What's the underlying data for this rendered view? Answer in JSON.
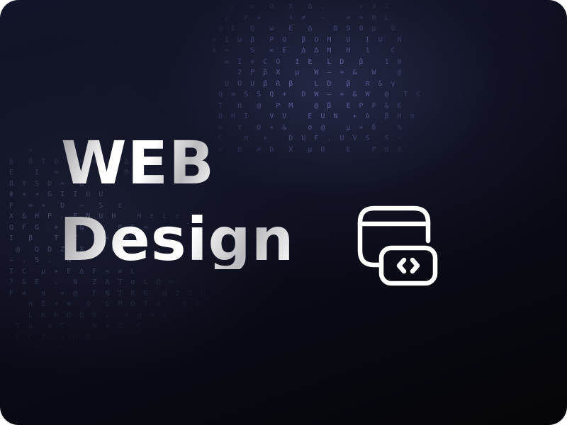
{
  "card": {
    "title_line1": "WEB",
    "title_line2": "Design",
    "icon": "browser-code-icon",
    "background_color": "#0b0c1a",
    "accent_color": "#8c96e6"
  },
  "matrix": {
    "top": "    α  ≠  Ο  X  Δ .     + X Z\n   μ  Ρ +    ÷ ≠  -   = ≈ H L\n  @ E  Q  ω  E  ∆   B 9 0 μ  6\n ≠ Ι ω β  Ρ Ο  β Ο Μ  U  I U  N\n Α +   S  ∞ E  ∆ ∆ M  H  1   C\n   ∞ Ι + C O  Ι E  L D  β   1 0\n     2 Ρ β X  μ  W – + &  W   @\n   U O U β R β   L D  β  R & γ\n  Q ∞ S S Q ∗  D W – + & W  @  T C\n  T  π  @  P M   @ β  E P F & E\n  B H I   V V   E U N  + A  β H π\n  ∞  Y  O ∗ &   σ @   μ + δ   %\n  C   π  +   D U F . U V S  S ·\n  ≠  B  ≠ D  X  μ O   E   P 8 X",
    "left": "    ≈     ∞  ≠    Ο\n β  δ Τ Ο ε ∞ ≠ Ο  ∆ .\n Ε   Ι  ∞    Ρ  Ω  Μ\n 8 Y S D ≈  ∆   H\n Φ + ∗ G I I U U\n F  ∞ ∗  D  –  S  ε\n X & H P . E N U H   H ε L ε\n Q F G  + & & ∞   B E ∞\n I  β   T  Z  ≈ ≈  ≈\n  @  Q D Z  X  β R\n – . S .  N\n T C  μ ∗ E ∆ F ≈ ≠ L\n ? & E  .  N  Z A T σ L O ∞\n F ≠  π  ∗ @  F N T R G  U Z I U\n    π I ∗ ⊕  Q  G M O T σ   Z R\n    L K H D Q V .  ∗ @ X &  R\n  T μ  σ C    N ∗ Z  C\n  V C T  ∗ U N\n   ≈ ∞   ∞"
  }
}
